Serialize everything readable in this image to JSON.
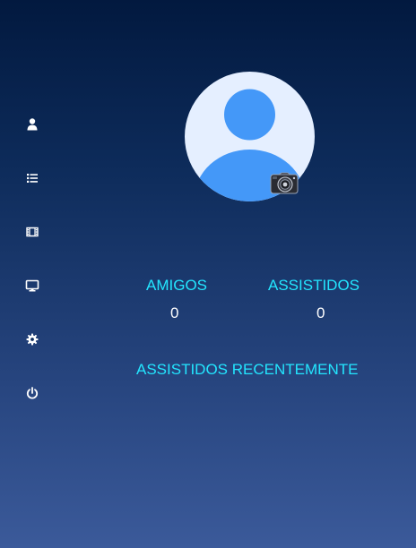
{
  "sidebar": {
    "items": [
      {
        "icon": "user-icon"
      },
      {
        "icon": "list-icon"
      },
      {
        "icon": "film-icon"
      },
      {
        "icon": "monitor-icon"
      },
      {
        "icon": "gear-icon"
      },
      {
        "icon": "power-icon"
      }
    ]
  },
  "profile": {
    "avatar_icon": "default-avatar-icon",
    "camera_icon": "camera-icon"
  },
  "stats": {
    "friends": {
      "label": "AMIGOS",
      "value": "0"
    },
    "watched": {
      "label": "ASSISTIDOS",
      "value": "0"
    }
  },
  "recent": {
    "title": "ASSISTIDOS RECENTEMENTE"
  },
  "colors": {
    "accent": "#23e6ff",
    "avatar_bg": "#e5efff",
    "avatar_fg": "#4498f8",
    "text": "#ffffff"
  }
}
